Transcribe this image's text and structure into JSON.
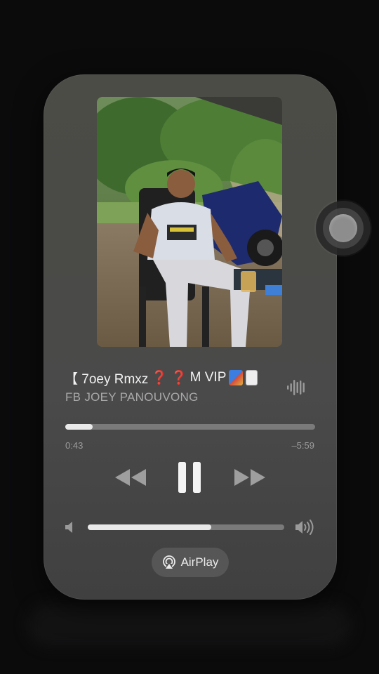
{
  "now_playing": {
    "title_prefix": "【 7oey Rmxz",
    "title_q1": "❓",
    "title_q2": "❓",
    "title_suffix": "M VIP",
    "artist": "FB  JOEY PANOUVONG",
    "progress": 0.11,
    "elapsed": "0:43",
    "remaining": "–5:59",
    "volume": 0.63,
    "output_label": "AirPlay"
  },
  "icons": {
    "waveform": "waveform-icon",
    "rewind": "rewind-icon",
    "pause": "pause-icon",
    "forward": "fast-forward-icon",
    "volume_low": "speaker-low-icon",
    "volume_high": "speaker-high-icon",
    "airplay": "airplay-icon",
    "assistive_touch": "assistive-touch-icon"
  },
  "colors": {
    "accent_red": "#e23a3a",
    "track_fill": "#e9e9e9",
    "track_bg": "#7a7a7a"
  }
}
